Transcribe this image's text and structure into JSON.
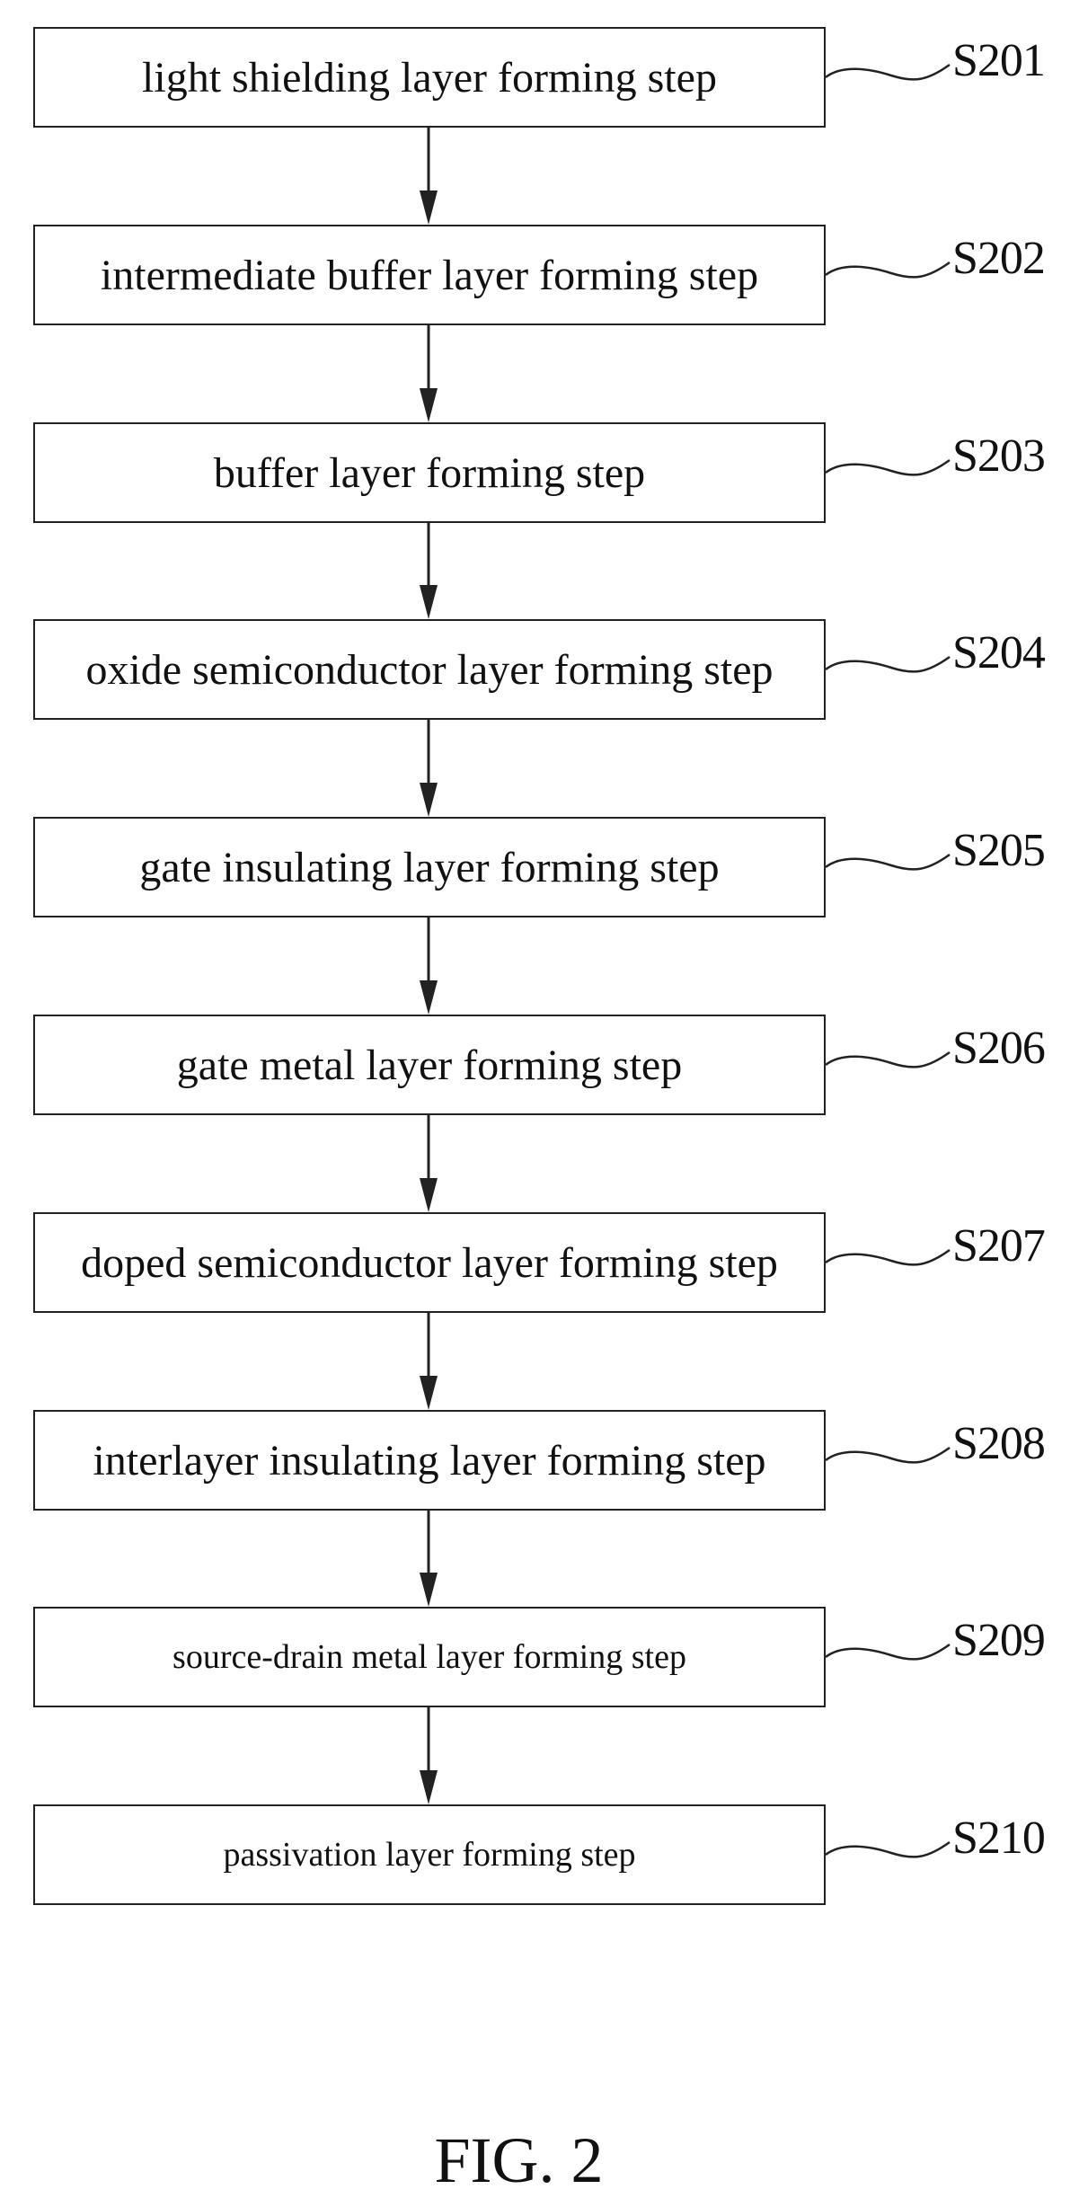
{
  "figure": {
    "caption": "FIG. 2",
    "steps": [
      {
        "id": "S201",
        "text": "light shielding layer forming step",
        "size": "normal"
      },
      {
        "id": "S202",
        "text": "intermediate buffer layer forming step",
        "size": "normal"
      },
      {
        "id": "S203",
        "text": "buffer layer forming step",
        "size": "normal"
      },
      {
        "id": "S204",
        "text": "oxide semiconductor layer forming step",
        "size": "normal"
      },
      {
        "id": "S205",
        "text": "gate insulating layer forming step",
        "size": "normal"
      },
      {
        "id": "S206",
        "text": "gate metal layer forming step",
        "size": "normal"
      },
      {
        "id": "S207",
        "text": "doped semiconductor layer forming step",
        "size": "normal"
      },
      {
        "id": "S208",
        "text": "interlayer insulating layer forming step",
        "size": "normal"
      },
      {
        "id": "S209",
        "text": "source-drain metal layer forming step",
        "size": "small"
      },
      {
        "id": "S210",
        "text": "passivation layer forming step",
        "size": "small"
      }
    ]
  }
}
